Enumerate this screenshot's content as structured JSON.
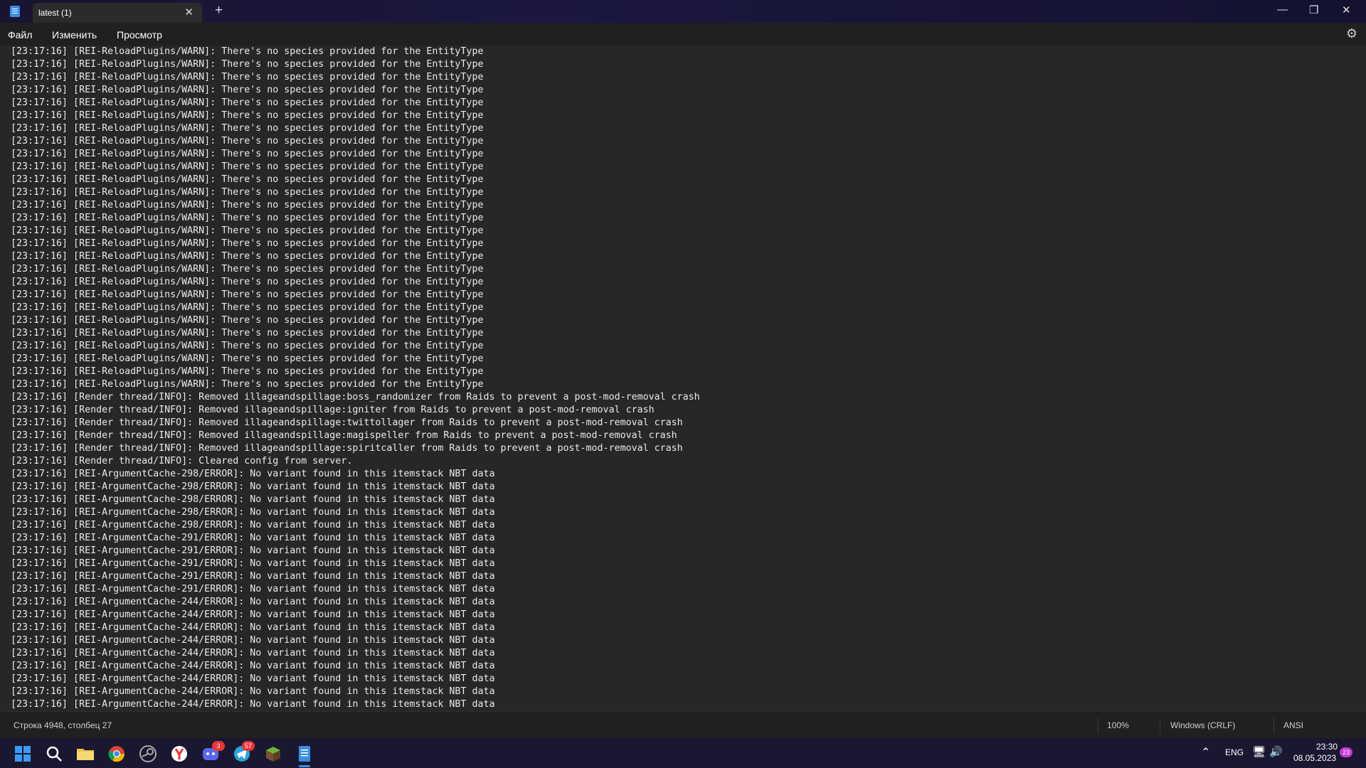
{
  "window": {
    "tab_title": "latest (1)",
    "close_tab": "✕",
    "new_tab": "+",
    "minimize": "—",
    "maximize": "❐",
    "close": "✕"
  },
  "menu": {
    "file": "Файл",
    "edit": "Изменить",
    "view": "Просмотр"
  },
  "editor": {
    "lines": [
      "[23:17:16] [REI-ReloadPlugins/WARN]: There's no species provided for the EntityType",
      "[23:17:16] [REI-ReloadPlugins/WARN]: There's no species provided for the EntityType",
      "[23:17:16] [REI-ReloadPlugins/WARN]: There's no species provided for the EntityType",
      "[23:17:16] [REI-ReloadPlugins/WARN]: There's no species provided for the EntityType",
      "[23:17:16] [REI-ReloadPlugins/WARN]: There's no species provided for the EntityType",
      "[23:17:16] [REI-ReloadPlugins/WARN]: There's no species provided for the EntityType",
      "[23:17:16] [REI-ReloadPlugins/WARN]: There's no species provided for the EntityType",
      "[23:17:16] [REI-ReloadPlugins/WARN]: There's no species provided for the EntityType",
      "[23:17:16] [REI-ReloadPlugins/WARN]: There's no species provided for the EntityType",
      "[23:17:16] [REI-ReloadPlugins/WARN]: There's no species provided for the EntityType",
      "[23:17:16] [REI-ReloadPlugins/WARN]: There's no species provided for the EntityType",
      "[23:17:16] [REI-ReloadPlugins/WARN]: There's no species provided for the EntityType",
      "[23:17:16] [REI-ReloadPlugins/WARN]: There's no species provided for the EntityType",
      "[23:17:16] [REI-ReloadPlugins/WARN]: There's no species provided for the EntityType",
      "[23:17:16] [REI-ReloadPlugins/WARN]: There's no species provided for the EntityType",
      "[23:17:16] [REI-ReloadPlugins/WARN]: There's no species provided for the EntityType",
      "[23:17:16] [REI-ReloadPlugins/WARN]: There's no species provided for the EntityType",
      "[23:17:16] [REI-ReloadPlugins/WARN]: There's no species provided for the EntityType",
      "[23:17:16] [REI-ReloadPlugins/WARN]: There's no species provided for the EntityType",
      "[23:17:16] [REI-ReloadPlugins/WARN]: There's no species provided for the EntityType",
      "[23:17:16] [REI-ReloadPlugins/WARN]: There's no species provided for the EntityType",
      "[23:17:16] [REI-ReloadPlugins/WARN]: There's no species provided for the EntityType",
      "[23:17:16] [REI-ReloadPlugins/WARN]: There's no species provided for the EntityType",
      "[23:17:16] [REI-ReloadPlugins/WARN]: There's no species provided for the EntityType",
      "[23:17:16] [REI-ReloadPlugins/WARN]: There's no species provided for the EntityType",
      "[23:17:16] [REI-ReloadPlugins/WARN]: There's no species provided for the EntityType",
      "[23:17:16] [REI-ReloadPlugins/WARN]: There's no species provided for the EntityType",
      "[23:17:16] [Render thread/INFO]: Removed illageandspillage:boss_randomizer from Raids to prevent a post-mod-removal crash",
      "[23:17:16] [Render thread/INFO]: Removed illageandspillage:igniter from Raids to prevent a post-mod-removal crash",
      "[23:17:16] [Render thread/INFO]: Removed illageandspillage:twittollager from Raids to prevent a post-mod-removal crash",
      "[23:17:16] [Render thread/INFO]: Removed illageandspillage:magispeller from Raids to prevent a post-mod-removal crash",
      "[23:17:16] [Render thread/INFO]: Removed illageandspillage:spiritcaller from Raids to prevent a post-mod-removal crash",
      "[23:17:16] [Render thread/INFO]: Cleared config from server.",
      "[23:17:16] [REI-ArgumentCache-298/ERROR]: No variant found in this itemstack NBT data",
      "[23:17:16] [REI-ArgumentCache-298/ERROR]: No variant found in this itemstack NBT data",
      "[23:17:16] [REI-ArgumentCache-298/ERROR]: No variant found in this itemstack NBT data",
      "[23:17:16] [REI-ArgumentCache-298/ERROR]: No variant found in this itemstack NBT data",
      "[23:17:16] [REI-ArgumentCache-298/ERROR]: No variant found in this itemstack NBT data",
      "[23:17:16] [REI-ArgumentCache-291/ERROR]: No variant found in this itemstack NBT data",
      "[23:17:16] [REI-ArgumentCache-291/ERROR]: No variant found in this itemstack NBT data",
      "[23:17:16] [REI-ArgumentCache-291/ERROR]: No variant found in this itemstack NBT data",
      "[23:17:16] [REI-ArgumentCache-291/ERROR]: No variant found in this itemstack NBT data",
      "[23:17:16] [REI-ArgumentCache-291/ERROR]: No variant found in this itemstack NBT data",
      "[23:17:16] [REI-ArgumentCache-244/ERROR]: No variant found in this itemstack NBT data",
      "[23:17:16] [REI-ArgumentCache-244/ERROR]: No variant found in this itemstack NBT data",
      "[23:17:16] [REI-ArgumentCache-244/ERROR]: No variant found in this itemstack NBT data",
      "[23:17:16] [REI-ArgumentCache-244/ERROR]: No variant found in this itemstack NBT data",
      "[23:17:16] [REI-ArgumentCache-244/ERROR]: No variant found in this itemstack NBT data",
      "[23:17:16] [REI-ArgumentCache-244/ERROR]: No variant found in this itemstack NBT data",
      "[23:17:16] [REI-ArgumentCache-244/ERROR]: No variant found in this itemstack NBT data",
      "[23:17:16] [REI-ArgumentCache-244/ERROR]: No variant found in this itemstack NBT data",
      "[23:17:16] [REI-ArgumentCache-244/ERROR]: No variant found in this itemstack NBT data",
      "[23:17:16] [REI-ArgumentCache-244/ERROR]: No variant found in this itemstack NBT data"
    ]
  },
  "status": {
    "position": "Строка 4948, столбец 27",
    "zoom": "100%",
    "line_ending": "Windows (CRLF)",
    "encoding": "ANSI"
  },
  "taskbar": {
    "discord_badge": "3",
    "telegram_badge": "57",
    "language": "ENG",
    "time": "23:30",
    "date": "08.05.2023",
    "notifications": "23"
  },
  "colors": {
    "title_bar": "#181530",
    "editor_bg": "#272727",
    "taskbar_bg": "#1a1830",
    "accent": "#3a8ee6"
  }
}
